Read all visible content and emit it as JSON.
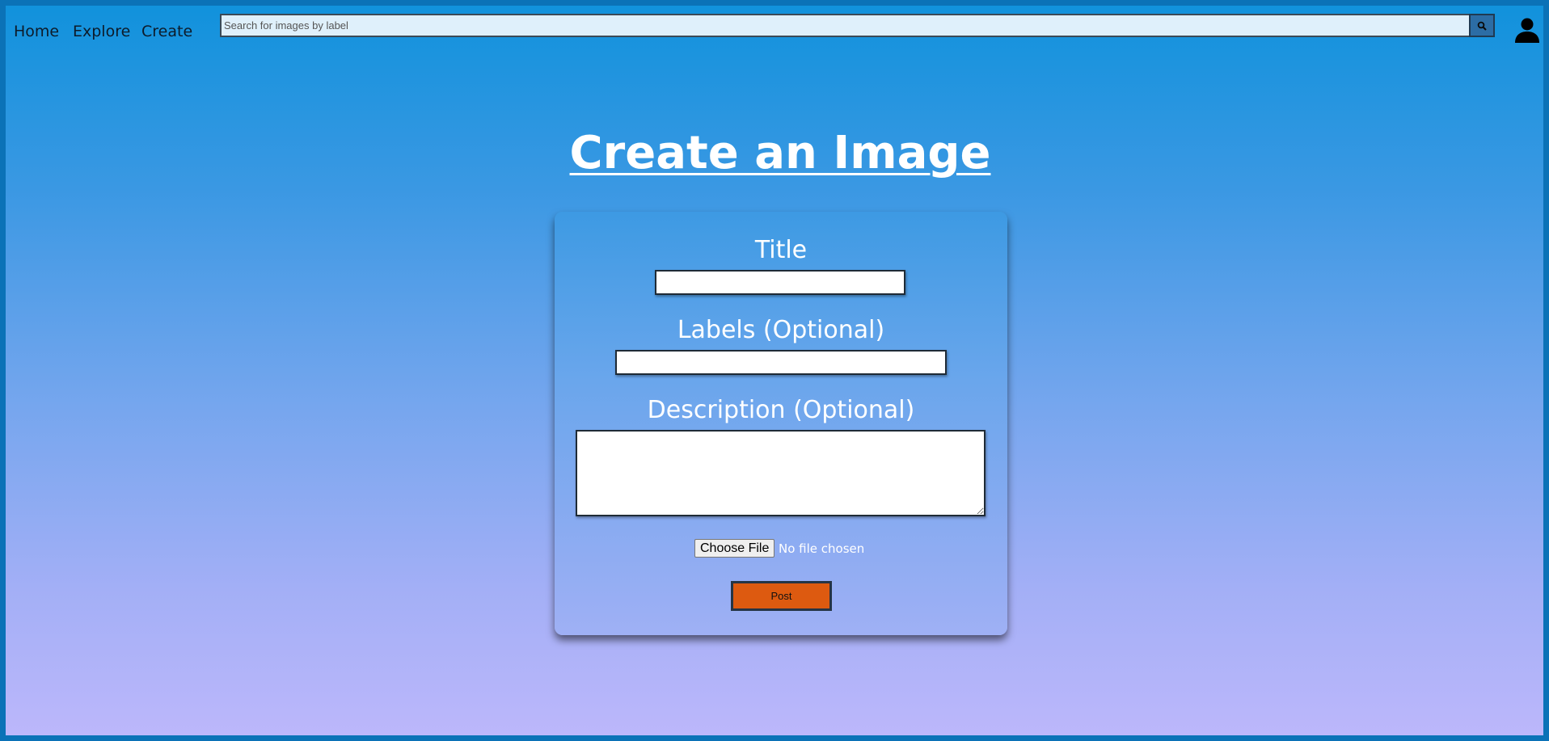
{
  "nav": {
    "links": [
      {
        "label": "Home"
      },
      {
        "label": "Explore"
      },
      {
        "label": "Create"
      }
    ],
    "search": {
      "placeholder": "Search for images by label",
      "value": "",
      "button_icon": "search-icon"
    },
    "account_icon": "user-icon"
  },
  "page": {
    "title": "Create an Image"
  },
  "form": {
    "title_label": "Title",
    "title_value": "",
    "labels_label": "Labels (Optional)",
    "labels_value": "",
    "description_label": "Description (Optional)",
    "description_value": "",
    "file_button_label": "Choose File",
    "file_status": "No file chosen",
    "submit_label": "Post"
  },
  "colors": {
    "background_top": "#1192dc",
    "background_bottom": "#bcb7fb",
    "frame_border": "#0b72b7",
    "post_button": "#dd5a10",
    "search_field": "#dff0fb"
  }
}
